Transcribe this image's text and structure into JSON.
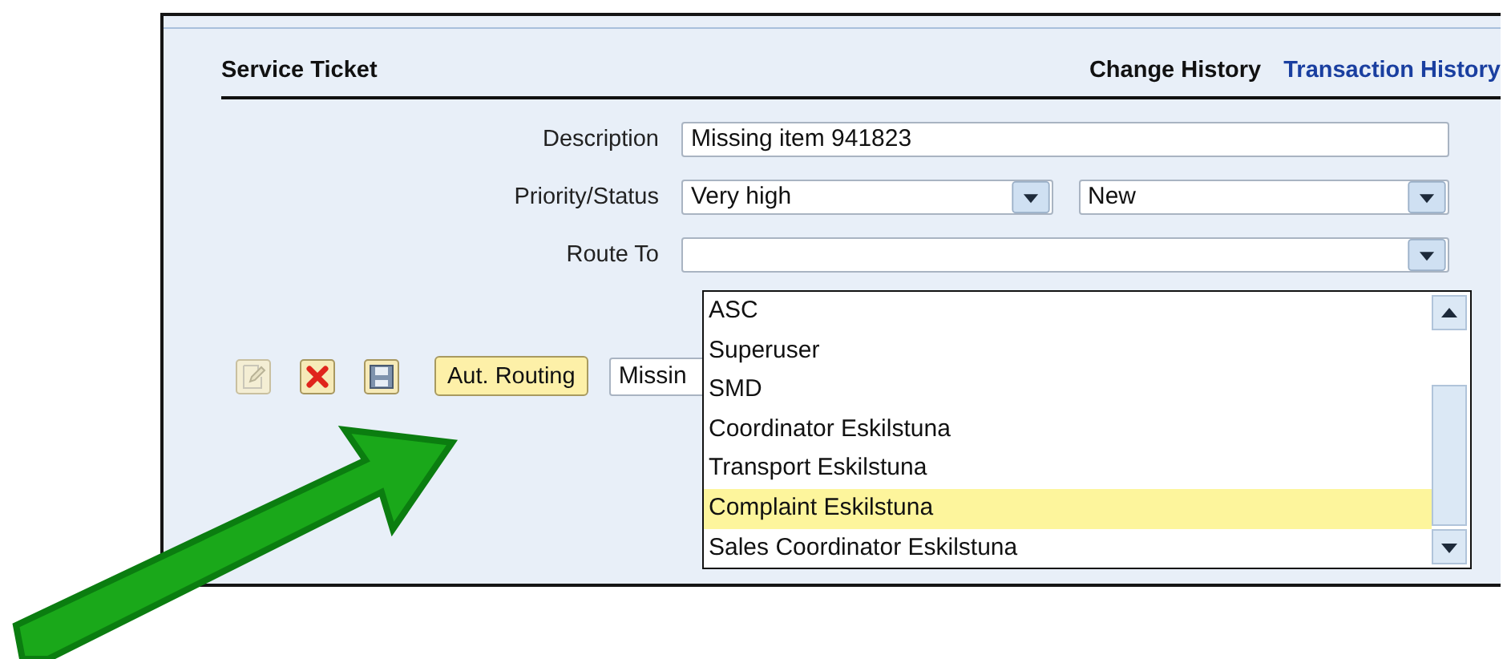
{
  "panel": {
    "title": "Service Ticket",
    "links": [
      {
        "label": "Change History",
        "selected": true
      },
      {
        "label": "Transaction History",
        "selected": false
      }
    ]
  },
  "form": [
    {
      "label": "Description",
      "kind": "text",
      "fields": [
        {
          "value": "Missing item 941823"
        }
      ]
    },
    {
      "label": "Priority/Status",
      "kind": "select",
      "fields": [
        {
          "value": "Very high"
        },
        {
          "value": "New"
        }
      ]
    },
    {
      "label": "Route To",
      "kind": "select_empty"
    }
  ],
  "toolbar": {
    "button": "Aut. Routing",
    "field_value": "Missin"
  },
  "dropdown": [
    {
      "label": "ASC",
      "selected": false
    },
    {
      "label": "Superuser",
      "selected": false
    },
    {
      "label": "SMD",
      "selected": false
    },
    {
      "label": "Coordinator Eskilstuna",
      "selected": false
    },
    {
      "label": "Transport Eskilstuna",
      "selected": false
    },
    {
      "label": "Complaint Eskilstuna",
      "selected": true
    },
    {
      "label": "Sales Coordinator Eskilstuna",
      "selected": false
    }
  ]
}
